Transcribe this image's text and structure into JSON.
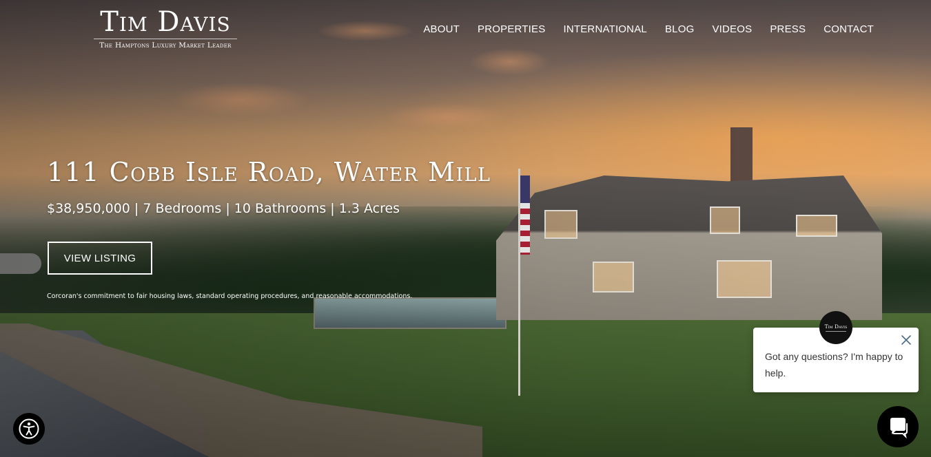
{
  "logo": {
    "name": "Tim Davis",
    "tagline": "The Hamptons Luxury Market Leader"
  },
  "nav": {
    "items": [
      {
        "label": "ABOUT"
      },
      {
        "label": "PROPERTIES"
      },
      {
        "label": "INTERNATIONAL"
      },
      {
        "label": "BLOG"
      },
      {
        "label": "VIDEOS"
      },
      {
        "label": "PRESS"
      },
      {
        "label": "CONTACT"
      }
    ]
  },
  "hero": {
    "title": "111 Cobb Isle Road, Water Mill",
    "details": "$38,950,000 | 7 Bedrooms | 10 Bathrooms | 1.3 Acres",
    "cta_label": "VIEW LISTING",
    "disclaimer": {
      "prefix": "Corcoran's commitment to ",
      "link1": "fair housing laws",
      "sep1": ", ",
      "link2": "standard operating procedures",
      "sep2": ", and ",
      "link3": "reasonable accommodations",
      "suffix": "."
    }
  },
  "chat": {
    "avatar_text": "Tim Davis",
    "message": "Got any questions? I'm happy to help."
  },
  "icons": {
    "accessibility": "accessibility-icon",
    "close": "close-icon",
    "chat": "chat-bubble-icon"
  },
  "colors": {
    "text": "#ffffff",
    "chat_bg": "#ffffff",
    "chat_text": "#333333",
    "launcher_bg": "#000000"
  }
}
